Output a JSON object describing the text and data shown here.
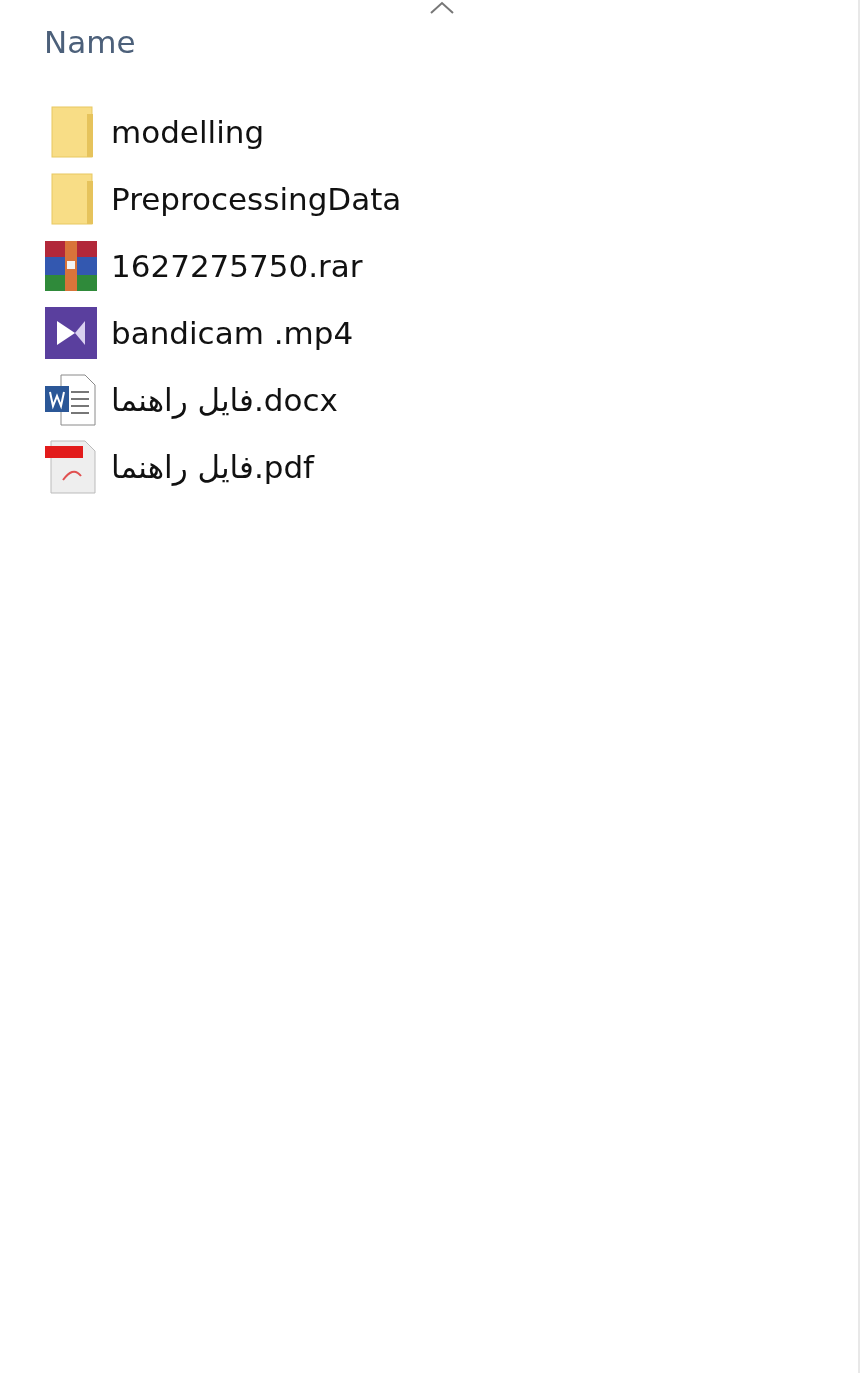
{
  "header": {
    "column": "Name",
    "sort_ascending": true
  },
  "files": [
    {
      "name": "modelling",
      "kind": "folder"
    },
    {
      "name": "PreprocessingData",
      "kind": "folder"
    },
    {
      "name": "1627275750.rar",
      "kind": "archive"
    },
    {
      "name": "bandicam .mp4",
      "kind": "video"
    },
    {
      "name": "فایل راهنما.docx",
      "kind": "word"
    },
    {
      "name": "فایل راهنما.pdf",
      "kind": "pdf"
    }
  ]
}
